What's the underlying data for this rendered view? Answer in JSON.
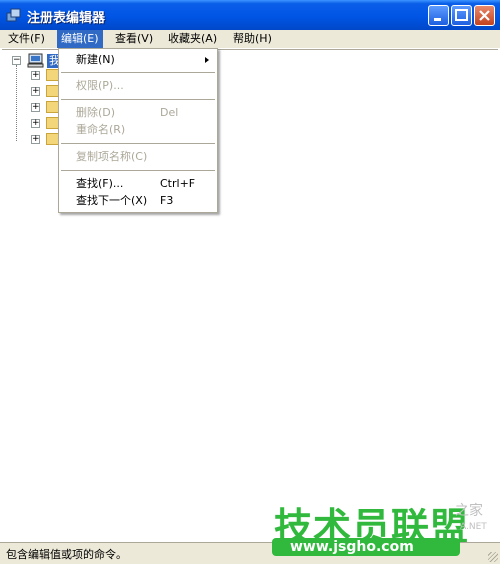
{
  "window": {
    "title": "注册表编辑器"
  },
  "menubar": [
    {
      "label": "文件(F)"
    },
    {
      "label": "编辑(E)"
    },
    {
      "label": "查看(V)"
    },
    {
      "label": "收藏夹(A)"
    },
    {
      "label": "帮助(H)"
    }
  ],
  "tree": {
    "root_label": "我"
  },
  "edit_menu": {
    "items": [
      {
        "label": "新建(N)",
        "enabled": true,
        "submenu": true
      },
      {
        "label": "权限(P)...",
        "enabled": false
      },
      {
        "label": "删除(D)",
        "shortcut": "Del",
        "enabled": false
      },
      {
        "label": "重命名(R)",
        "enabled": false
      },
      {
        "label": "复制项名称(C)",
        "enabled": false
      },
      {
        "label": "查找(F)...",
        "shortcut": "Ctrl+F",
        "enabled": true
      },
      {
        "label": "查找下一个(X)",
        "shortcut": "F3",
        "enabled": true
      }
    ]
  },
  "status": {
    "text": "包含编辑值或项的命令。"
  },
  "watermark": {
    "title": "技术员联盟",
    "url": "www.jsgho.com",
    "side_text": "之家",
    "side_text2": "A.NET"
  }
}
